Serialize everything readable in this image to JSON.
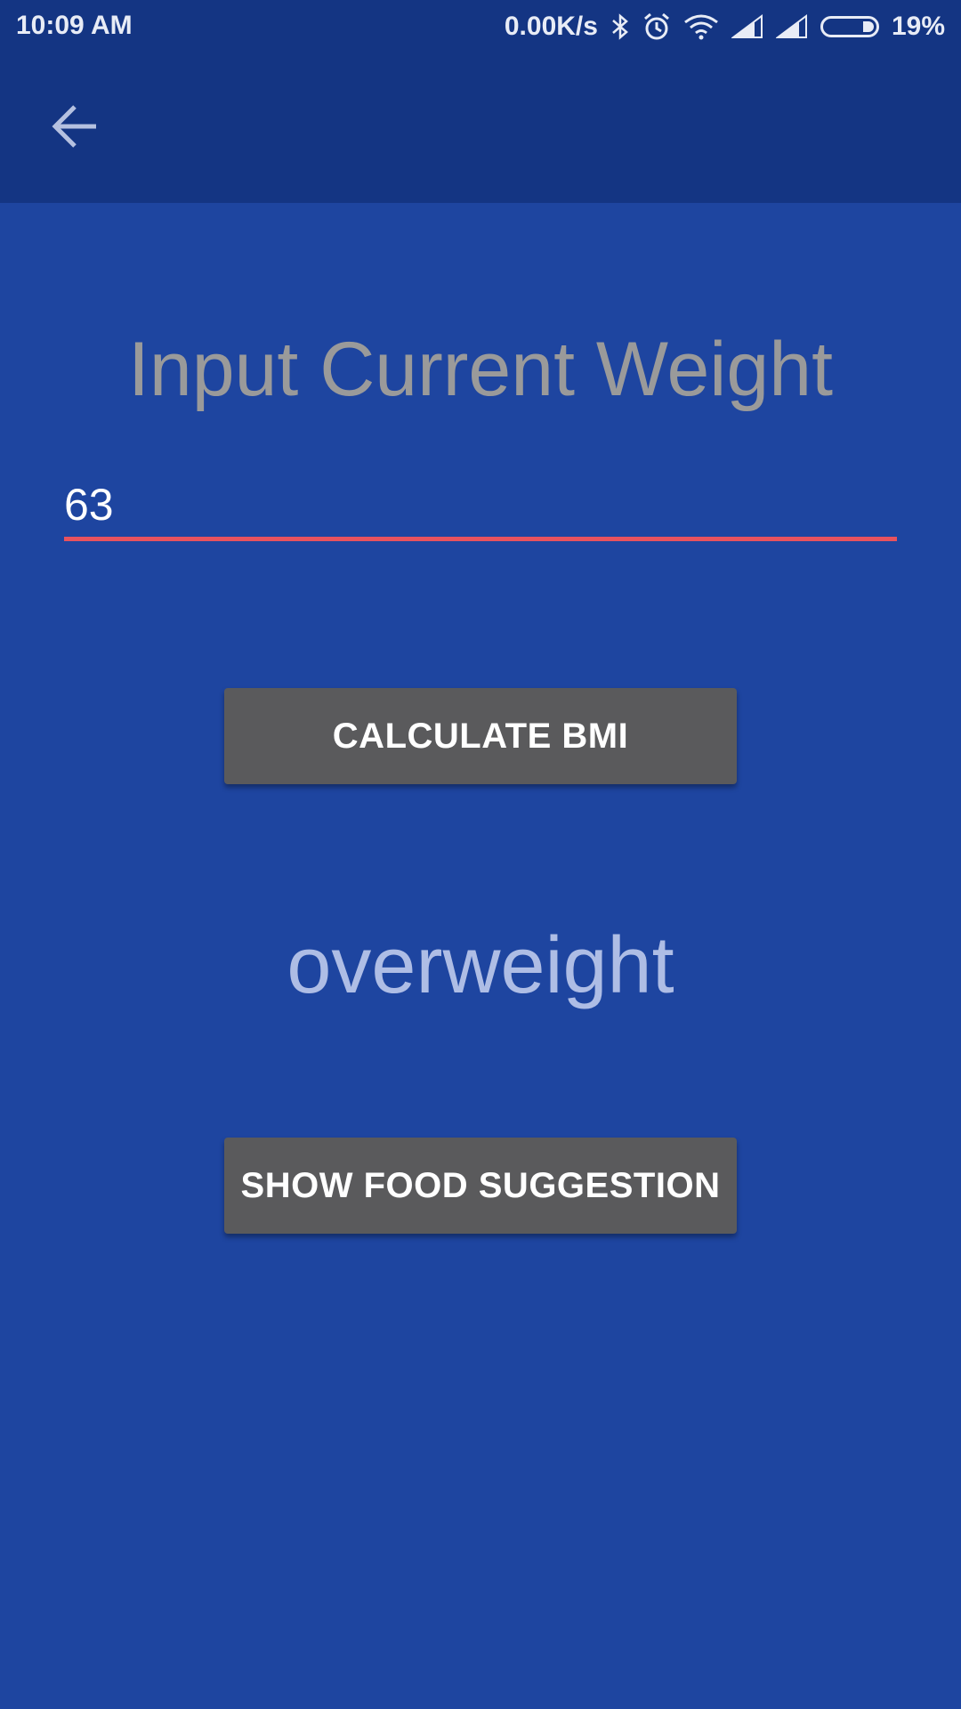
{
  "status_bar": {
    "time": "10:09 AM",
    "network_speed": "0.00K/s",
    "battery_percent": "19%",
    "icons": [
      "bluetooth-icon",
      "alarm-icon",
      "wifi-icon",
      "signal-icon",
      "signal-icon",
      "battery-icon"
    ]
  },
  "app_bar": {
    "back_icon": "arrow-back-icon"
  },
  "main": {
    "heading": "Input Current Weight",
    "weight_value": "63",
    "calculate_label": "CALCULATE BMI",
    "result": "overweight",
    "food_label": "SHOW FOOD SUGGESTION"
  },
  "colors": {
    "background": "#1e45a0",
    "app_bar": "#143583",
    "button": "#5a5a5c",
    "input_underline": "#e8525e"
  }
}
